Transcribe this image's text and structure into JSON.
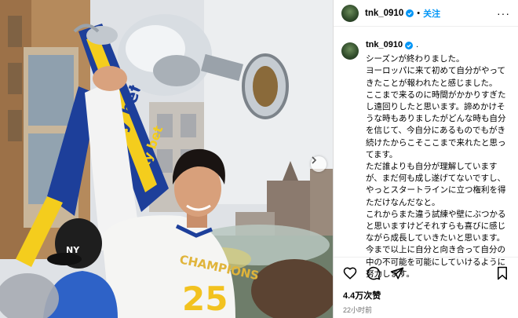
{
  "header": {
    "username": "tnk_0910",
    "separator": "•",
    "follow_label": "关注",
    "more_label": "···"
  },
  "caption": {
    "username": "tnk_0910",
    "separator": ".",
    "text": "シーズンが終わりました。\nヨーロッパに来て初めて自分がやってきたことが報われたと感じました。\nここまで来るのに時間がかかりすぎたし遠回りしたと思います。諦めかけそうな時もありましたがどんな時も自分を信じて、今自分にあるものでもがき続けたからこそここまで来れたと思ってます。\nただ誰よりも自分が理解していますが、まだ何も成し遂げてないですし、やっとスタートラインに立つ権利を得ただけなんだなと。\nこれからまた違う試練や壁にぶつかると思いますけどそれすらも喜びに感じながら成長していきたいと思います。\n今まで以上に自分と向き合って自分の中の不可能を可能にしていけるように努力します。"
  },
  "footer": {
    "likes": "4.4万次赞",
    "time": "22小时前"
  },
  "photo": {
    "banner_text": "sky bet",
    "shirt_text": "CHAMPIONS",
    "shirt_number": "25",
    "cap_logo": "NY"
  },
  "icons": {
    "verified": "verified-badge-icon",
    "like": "heart-icon",
    "comment": "comment-icon",
    "share": "paper-plane-icon",
    "save": "bookmark-icon",
    "next": "chevron-right-icon"
  },
  "colors": {
    "accent": "#0095f6",
    "verified": "#0095f6",
    "muted": "#737373",
    "banner_blue": "#1d3f9a",
    "banner_yellow": "#f4cd1d"
  }
}
